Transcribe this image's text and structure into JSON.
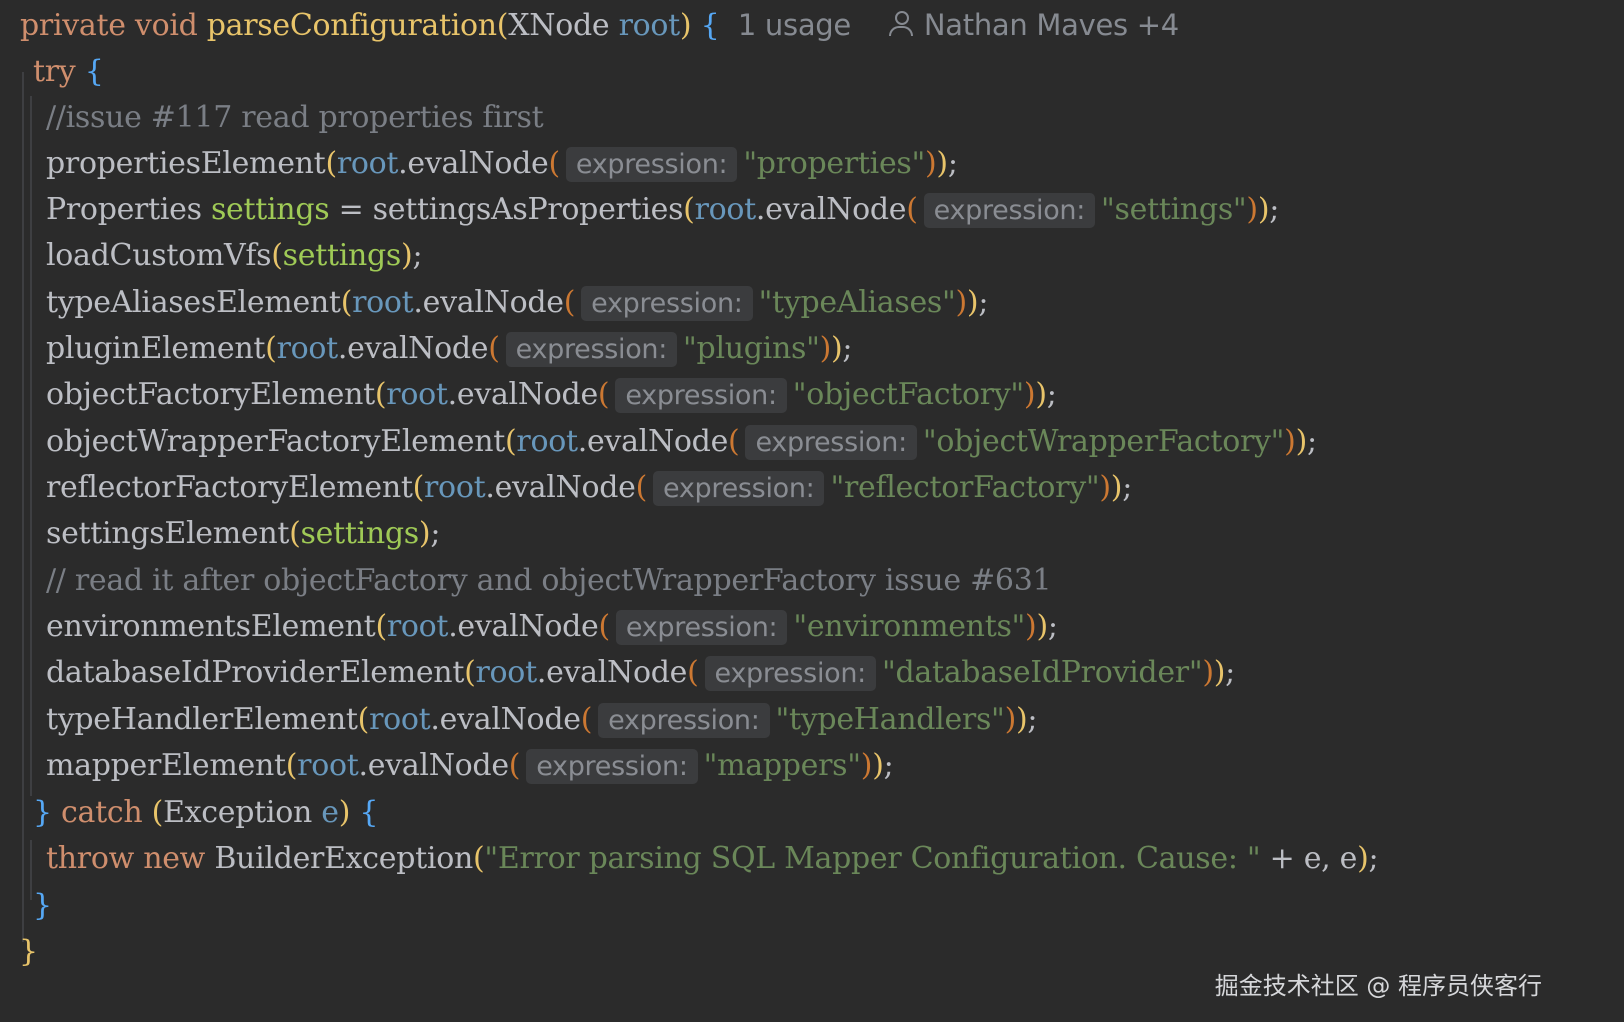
{
  "signature": {
    "modifiers": "private void",
    "method_name": "parseConfiguration",
    "open_paren": "(",
    "param_type": "XNode",
    "param_name": "root",
    "close_paren": ")",
    "brace": "{",
    "usage": "1 usage",
    "author": "Nathan Maves +4",
    "author_icon": "user-icon"
  },
  "code": {
    "try_kw": "try",
    "try_brace": "{",
    "comment1": "//issue #117 read properties first",
    "expression_hint": "expression:",
    "root": "root",
    "eval_node": ".evalNode",
    "lines": {
      "properties": {
        "call": "propertiesElement",
        "arg": "\"properties\""
      },
      "settings_type": "Properties",
      "settings_var": "settings",
      "settings_assign": " = ",
      "settings_call": "settingsAsProperties",
      "settings_arg": "\"settings\"",
      "load_vfs": "loadCustomVfs",
      "type_aliases": {
        "call": "typeAliasesElement",
        "arg": "\"typeAliases\""
      },
      "plugin": {
        "call": "pluginElement",
        "arg": "\"plugins\""
      },
      "object_factory": {
        "call": "objectFactoryElement",
        "arg": "\"objectFactory\""
      },
      "object_wrapper": {
        "call": "objectWrapperFactoryElement",
        "arg": "\"objectWrapperFactory\""
      },
      "reflector": {
        "call": "reflectorFactoryElement",
        "arg": "\"reflectorFactory\""
      },
      "settings_element": "settingsElement",
      "comment2": "// read it after objectFactory and objectWrapperFactory issue #631",
      "environments": {
        "call": "environmentsElement",
        "arg": "\"environments\""
      },
      "database_id": {
        "call": "databaseIdProviderElement",
        "arg": "\"databaseIdProvider\""
      },
      "type_handler": {
        "call": "typeHandlerElement",
        "arg": "\"typeHandlers\""
      },
      "mapper": {
        "call": "mapperElement",
        "arg": "\"mappers\""
      }
    },
    "catch_close": "}",
    "catch_kw": "catch",
    "exception_type": "Exception",
    "exception_var": "e",
    "throw_kw": "throw new",
    "builder_exception": "BuilderException",
    "error_msg": "\"Error parsing SQL Mapper Configuration. Cause: \"",
    "concat": " + e, e",
    "close_try": "}",
    "close_method": "}"
  },
  "watermark": "掘金技术社区 @ 程序员侠客行"
}
